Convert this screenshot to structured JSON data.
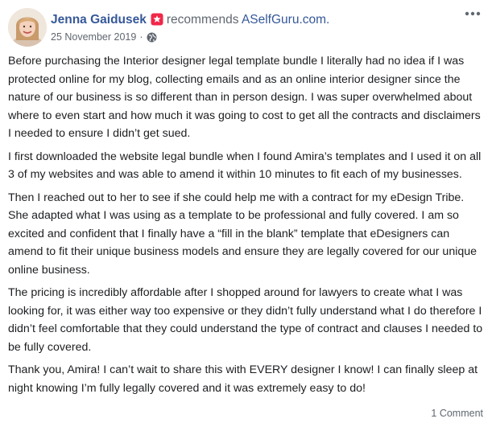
{
  "post": {
    "author": "Jenna Gaidusek",
    "action": "recommends",
    "page": "ASelfGuru.com.",
    "date": "25 November 2019",
    "separator": "·",
    "icons": {
      "recommend": "recommend-icon",
      "privacy": "globe-icon",
      "more": "more-options-icon",
      "avatar": "avatar"
    },
    "colors": {
      "link": "#365899",
      "recommend": "#f02849",
      "meta": "#606770",
      "text": "#1c1e21"
    },
    "paragraphs": [
      "Before purchasing the Interior designer legal template bundle I literally had no idea if I was protected online for my blog, collecting emails and as an online interior designer since the nature of our business is so different than in person design. I was super overwhelmed about where to even start and how much it was going to cost to get all the contracts and disclaimers I needed to ensure I didn’t get sued.",
      "I first downloaded the website legal bundle when I found Amira’s templates and I used it on all 3 of my websites and was able to amend it within 10 minutes to fit each of my businesses.",
      "Then I reached out to her to see if she could help me with a contract for my eDesign Tribe. She adapted what I was using as a template to be professional and fully covered. I am so excited and confident that I finally have a “fill in the blank” template that eDesigners can amend to fit their unique business models and ensure they are legally covered for our unique online business.",
      "The pricing is incredibly affordable after I shopped around for lawyers to create what I was looking for, it was either way too expensive or they didn’t fully understand what I do therefore I didn’t feel comfortable that they could understand the type of contract and clauses I needed to be fully covered.",
      "Thank you, Amira! I can’t wait to share this with EVERY designer I know! I can finally sleep at night knowing I’m fully legally covered and it was extremely easy to do!"
    ],
    "comments_label": "1 Comment"
  }
}
